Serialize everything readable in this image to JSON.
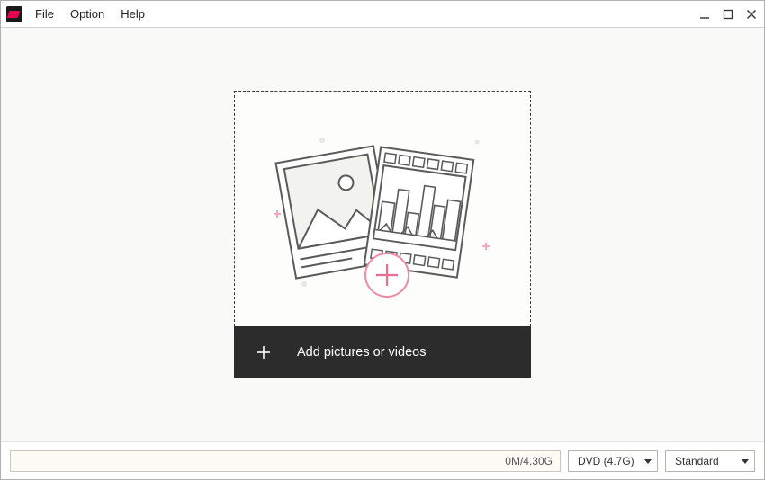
{
  "menu": {
    "file": "File",
    "option": "Option",
    "help": "Help"
  },
  "dropzone": {
    "button_label": "Add pictures or videos"
  },
  "bottombar": {
    "progress_text": "0M/4.30G",
    "disc_selected": "DVD (4.7G)",
    "quality_selected": "Standard"
  }
}
